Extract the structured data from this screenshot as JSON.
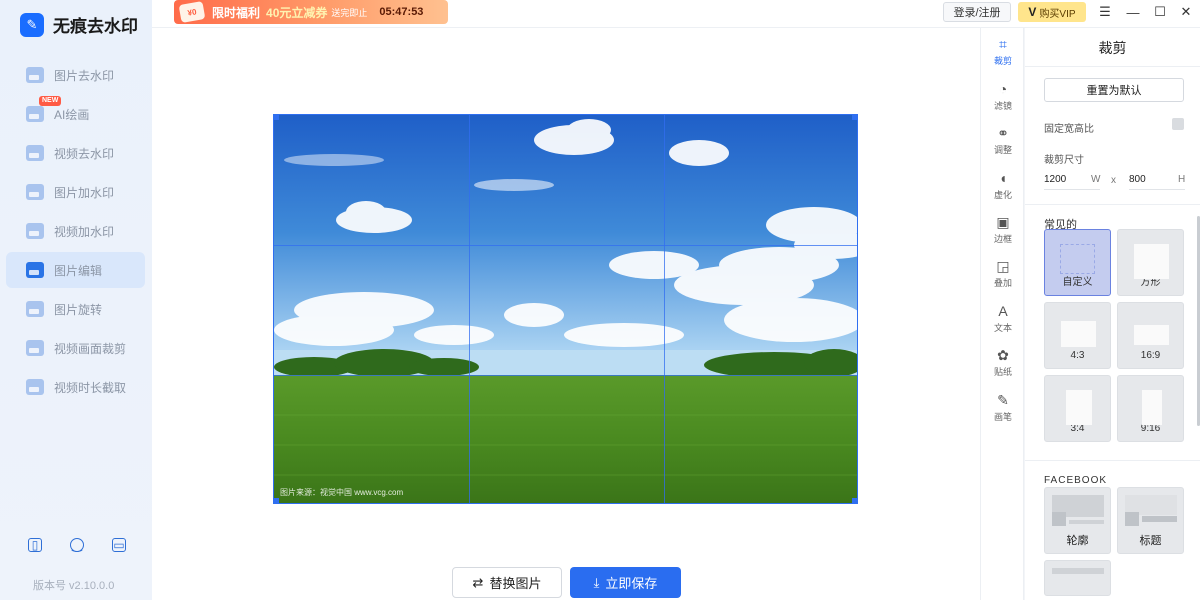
{
  "app": {
    "name": "无痕去水印",
    "logo_glyph": "✎",
    "version": "版本号 v2.10.0.0"
  },
  "nav": {
    "items": [
      {
        "label": "图片去水印"
      },
      {
        "label": "AI绘画",
        "badge": "NEW"
      },
      {
        "label": "视频去水印"
      },
      {
        "label": "图片加水印"
      },
      {
        "label": "视频加水印"
      },
      {
        "label": "图片编辑",
        "active": true
      },
      {
        "label": "图片旋转"
      },
      {
        "label": "视频画面裁剪"
      },
      {
        "label": "视频时长截取"
      }
    ]
  },
  "sidebar_icons": [
    "phone-icon",
    "smile-icon",
    "window-icon"
  ],
  "promo": {
    "tag": "¥0",
    "title": "限时福利",
    "coupon": "40元立减券",
    "sub": "送完即止",
    "timer": "05:47:53"
  },
  "header": {
    "login": "登录/注册",
    "vip_mark": "V",
    "vip": "购买VIP"
  },
  "canvas": {
    "credit": "图片来源：视觉中国 www.vcg.com"
  },
  "actions": {
    "replace": "替换图片",
    "save": "立即保存"
  },
  "tools": [
    {
      "label": "裁剪",
      "icon": "crop-icon",
      "active": true
    },
    {
      "label": "滤镜",
      "icon": "filter-icon"
    },
    {
      "label": "调整",
      "icon": "adjust-icon"
    },
    {
      "label": "虚化",
      "icon": "blur-icon"
    },
    {
      "label": "边框",
      "icon": "border-icon"
    },
    {
      "label": "叠加",
      "icon": "overlay-icon"
    },
    {
      "label": "文本",
      "icon": "text-icon"
    },
    {
      "label": "贴纸",
      "icon": "sticker-icon"
    },
    {
      "label": "画笔",
      "icon": "brush-icon"
    }
  ],
  "panel": {
    "title": "裁剪",
    "reset": "重置为默认",
    "lock_ratio": "固定宽高比",
    "crop_size": "裁剪尺寸",
    "width": "1200",
    "width_unit": "W",
    "x": "x",
    "height": "800",
    "height_unit": "H",
    "common_title": "常见的",
    "presets": [
      {
        "label": "自定义",
        "active": true
      },
      {
        "label": "方形"
      },
      {
        "label": "4:3"
      },
      {
        "label": "16:9"
      },
      {
        "label": "3:4"
      },
      {
        "label": "9:16"
      }
    ],
    "facebook_title": "FACEBOOK",
    "facebook": [
      {
        "label": "轮廓"
      },
      {
        "label": "标题"
      }
    ]
  }
}
